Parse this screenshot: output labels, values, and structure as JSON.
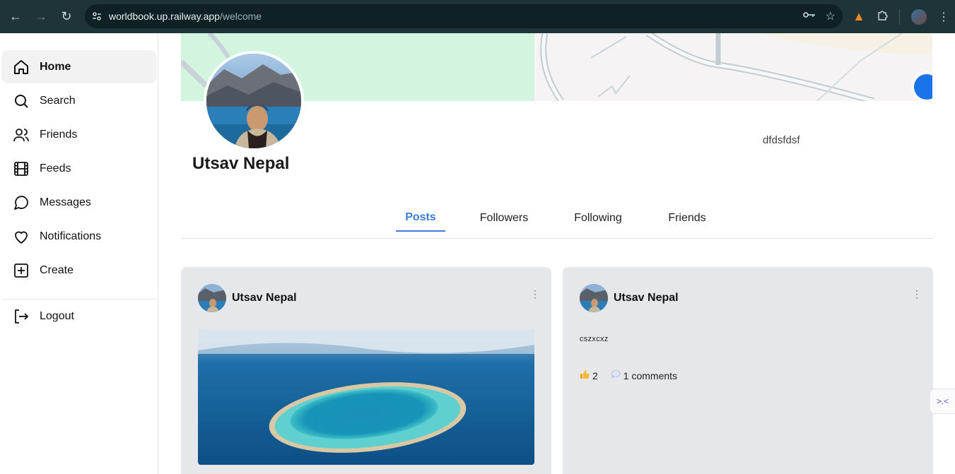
{
  "browser": {
    "url_host": "worldbook.up.railway.app",
    "url_path": "/welcome",
    "icons": [
      "back-icon",
      "forward-icon",
      "reload-icon",
      "site-info-icon",
      "key-icon",
      "star-icon",
      "fox-extension-icon",
      "puzzle-icon",
      "profile-icon",
      "more-icon"
    ]
  },
  "sidebar": {
    "items": [
      {
        "label": "Home",
        "icon": "home-icon",
        "active": true
      },
      {
        "label": "Search",
        "icon": "search-icon"
      },
      {
        "label": "Friends",
        "icon": "users-icon"
      },
      {
        "label": "Feeds",
        "icon": "film-icon"
      },
      {
        "label": "Messages",
        "icon": "message-icon"
      },
      {
        "label": "Notifications",
        "icon": "heart-icon"
      },
      {
        "label": "Create",
        "icon": "plus-square-icon"
      }
    ],
    "logout": {
      "label": "Logout",
      "icon": "logout-icon"
    }
  },
  "profile": {
    "name": "Utsav Nepal",
    "bio": "dfdsfdsf"
  },
  "tabs": [
    {
      "label": "Posts",
      "active": true
    },
    {
      "label": "Followers"
    },
    {
      "label": "Following"
    },
    {
      "label": "Friends"
    }
  ],
  "posts": [
    {
      "author": "Utsav Nepal",
      "has_image": true
    },
    {
      "author": "Utsav Nepal",
      "text": "cszxcxz",
      "likes": "2",
      "comments": "1 comments"
    }
  ],
  "colors": {
    "accent": "#3b7dd8",
    "chrome": "#1f3438",
    "card": "#e6e7eb"
  }
}
